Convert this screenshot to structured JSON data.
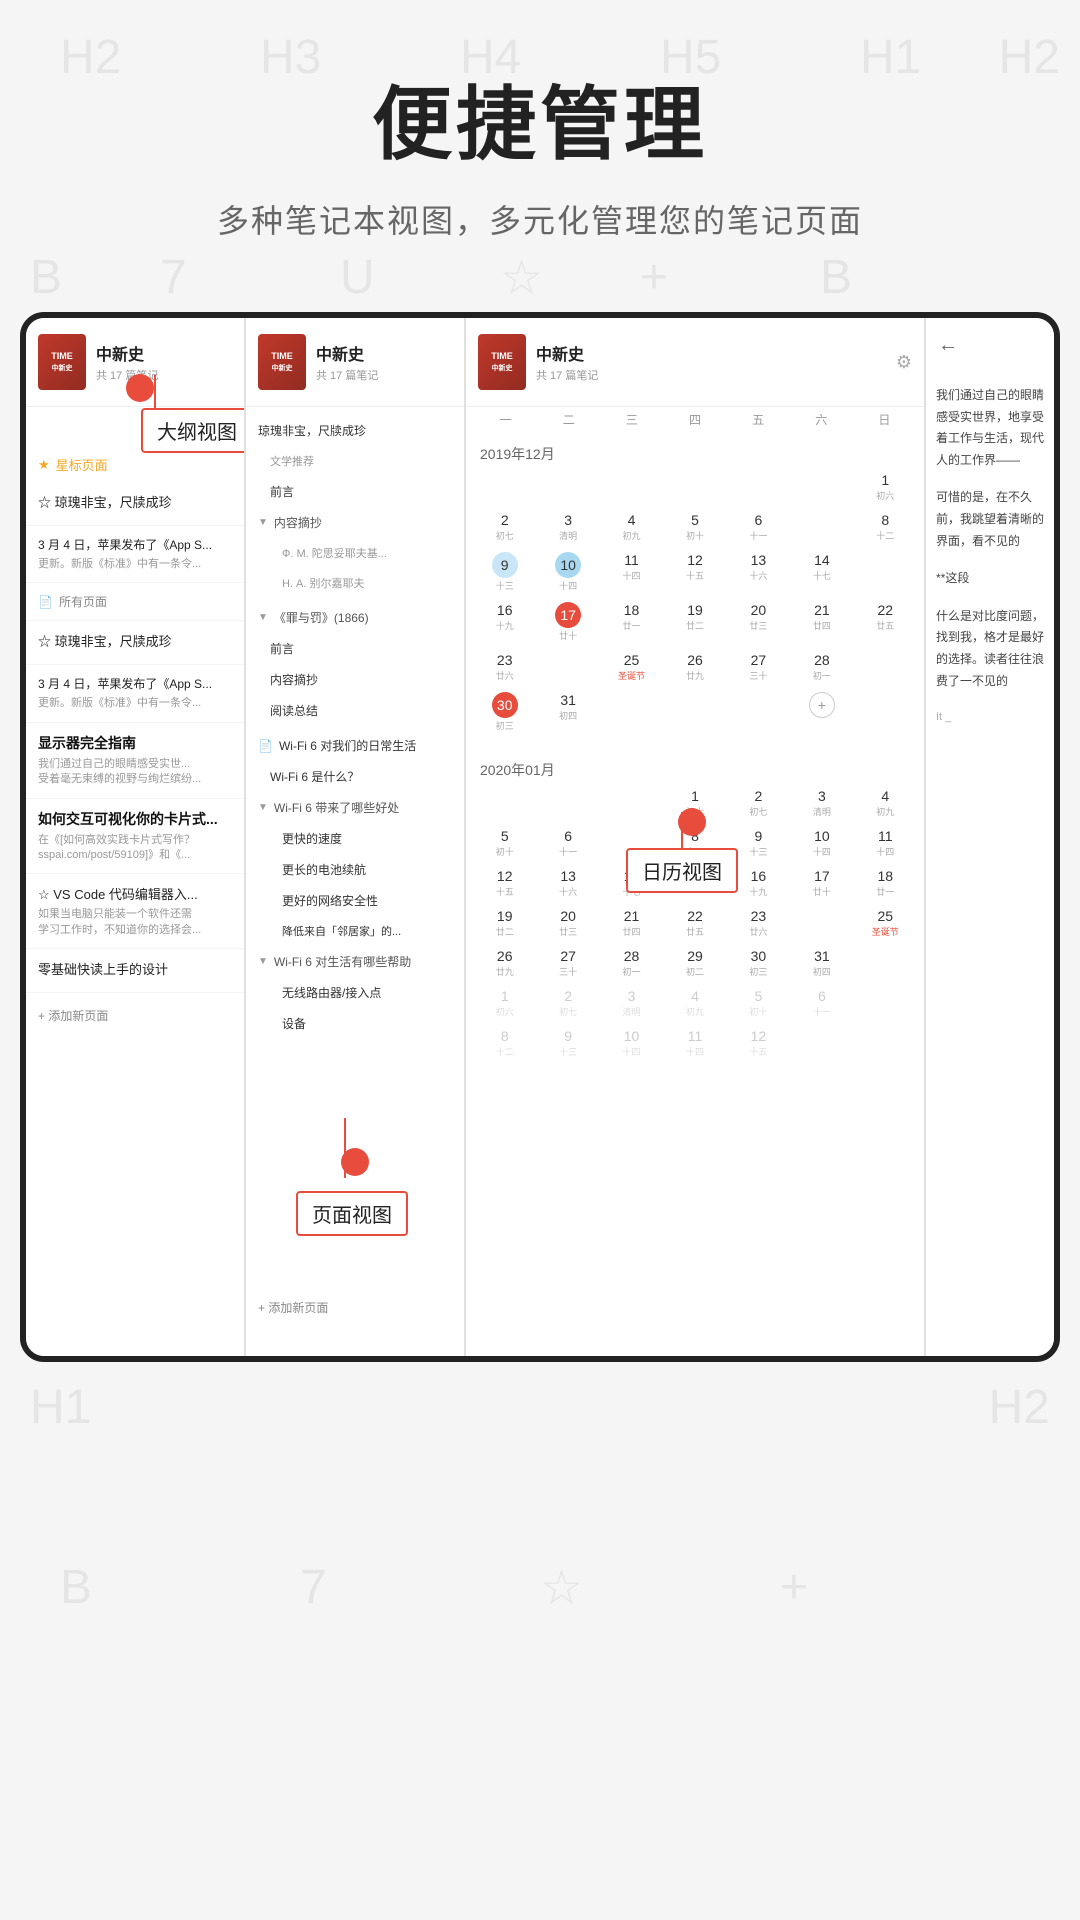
{
  "page": {
    "title": "便捷管理",
    "subtitle": "多种笔记本视图，多元化管理您的笔记页面"
  },
  "watermark_symbols": [
    "H2",
    "H3",
    "H4",
    "H5",
    "H2",
    "B",
    "7",
    "U",
    "☆",
    "+",
    "B",
    "H1",
    "H2"
  ],
  "notebook": {
    "name": "中新史",
    "count": "共 17 篇笔记",
    "count2": "共 17 篇笔记"
  },
  "panel1": {
    "label": "大纲视图",
    "starred_label": "星标页面",
    "items": [
      {
        "title": "☆ 琼瑰非宝，尺牍成珍",
        "desc": "",
        "type": "starred"
      },
      {
        "title": "3 月 4 日，苹果发布了《App S...",
        "desc": "更新。新版《标准》中有一条令...",
        "type": "desc"
      },
      {
        "title": "VS Code 代码编辑器入...",
        "desc": "如果当电脑只能装一个软件还需\n学习工作时，不知道你的选择会...",
        "type": "desc",
        "bold": true
      },
      {
        "title": "所有页面",
        "type": "section"
      },
      {
        "title": "☆ 琼瑰非宝，尺牍成珍",
        "type": "starred-plain"
      },
      {
        "title": "3 月 4 日，苹果发布了《App S...",
        "desc": "更新。新版《标准》中有一条令...",
        "type": "desc"
      },
      {
        "title": "显示器完全指南",
        "type": "bold-title"
      },
      {
        "title": "我们通过自己的眼睛感受实世...",
        "desc": "受着毫无束缚的视野与绚烂缤纷...",
        "type": "desc"
      },
      {
        "title": "如何交互可视化你的卡片式...",
        "type": "bold-title"
      },
      {
        "title": "在《[如何高效实践卡片式写作？sspai.com/post/59109]》和《...",
        "type": "desc-small"
      },
      {
        "title": "☆ VS Code 代码编辑器入...",
        "type": "starred-plain"
      },
      {
        "title": "如果当电脑只能装一个软件还需\n学习工作时，不知道你的选择会...",
        "type": "desc"
      },
      {
        "title": "零基础快读上手的设计",
        "type": "normal"
      }
    ],
    "add_page": "+ 添加新页面"
  },
  "panel2": {
    "label": "页面视图",
    "outline_items": [
      {
        "text": "琼瑰非宝，尺牍成珍",
        "type": "top",
        "indent": 0
      },
      {
        "text": "文学推荐",
        "type": "sub",
        "indent": 1
      },
      {
        "text": "前言",
        "type": "item",
        "indent": 1
      },
      {
        "text": "内容摘抄",
        "type": "expand",
        "indent": 1
      },
      {
        "text": "Ф. М. 陀思妥耶夫基...",
        "type": "item",
        "indent": 2
      },
      {
        "text": "Н. А. 别尔嘉耶夫",
        "type": "item",
        "indent": 2
      },
      {
        "text": "《罪与罚》(1866)",
        "type": "expand-item",
        "indent": 0
      },
      {
        "text": "前言",
        "type": "item",
        "indent": 1
      },
      {
        "text": "内容摘抄",
        "type": "item",
        "indent": 1
      },
      {
        "text": "阅读总结",
        "type": "item",
        "indent": 1
      },
      {
        "text": "Wi-Fi 6 对我们的日常生活",
        "type": "file",
        "indent": 0
      },
      {
        "text": "Wi-Fi 6 是什么？",
        "type": "item",
        "indent": 1
      },
      {
        "text": "Wi-Fi 6 带来了哪些好处",
        "type": "expand",
        "indent": 1
      },
      {
        "text": "更快的速度",
        "type": "item",
        "indent": 2
      },
      {
        "text": "更长的电池续航",
        "type": "item",
        "indent": 2
      },
      {
        "text": "更好的网络安全性",
        "type": "item",
        "indent": 2
      },
      {
        "text": "降低来自「邻居家」的...",
        "type": "item",
        "indent": 2
      },
      {
        "text": "Wi-Fi 6 对生活有哪些帮助",
        "type": "expand",
        "indent": 1
      },
      {
        "text": "无线路由器/接入点",
        "type": "item",
        "indent": 2
      },
      {
        "text": "设备",
        "type": "item",
        "indent": 2
      }
    ],
    "add_page": "+ 添加新页面"
  },
  "calendar": {
    "label": "日历视图",
    "month1": "2019年12月",
    "month2": "2020年01月",
    "month3": "2020年",
    "weekdays": [
      "一",
      "二",
      "三",
      "四",
      "五",
      "六",
      "日"
    ],
    "dec2019": [
      {
        "num": "",
        "lunar": ""
      },
      {
        "num": "",
        "lunar": ""
      },
      {
        "num": "",
        "lunar": ""
      },
      {
        "num": "",
        "lunar": ""
      },
      {
        "num": "",
        "lunar": ""
      },
      {
        "num": "",
        "lunar": ""
      },
      {
        "num": "1",
        "lunar": "初六"
      },
      {
        "num": "2",
        "lunar": "初七"
      },
      {
        "num": "3",
        "lunar": "清明"
      },
      {
        "num": "4",
        "lunar": "初九"
      },
      {
        "num": "5",
        "lunar": "初十"
      },
      {
        "num": "6",
        "lunar": "十一"
      },
      {
        "num": "8",
        "lunar": "十二"
      },
      {
        "num": "9",
        "lunar": "十三",
        "selected": true
      },
      {
        "num": "10",
        "lunar": "十四",
        "selected2": true
      },
      {
        "num": "11",
        "lunar": "十四"
      },
      {
        "num": "12",
        "lunar": "十五"
      },
      {
        "num": "13",
        "lunar": "十六"
      },
      {
        "num": "14",
        "lunar": "十七"
      },
      {
        "num": "16",
        "lunar": "十九"
      },
      {
        "num": "17",
        "lunar": "廿十",
        "today": true
      },
      {
        "num": "18",
        "lunar": "廿一"
      },
      {
        "num": "19",
        "lunar": "廿二"
      },
      {
        "num": "20",
        "lunar": "廿三"
      },
      {
        "num": "21",
        "lunar": "廿四"
      },
      {
        "num": "22",
        "lunar": "廿五"
      },
      {
        "num": "23",
        "lunar": "廿六"
      },
      {
        "num": "25",
        "lunar": "圣诞节",
        "special": true
      },
      {
        "num": "26",
        "lunar": "廿九"
      },
      {
        "num": "27",
        "lunar": "三十"
      },
      {
        "num": "28",
        "lunar": "初一"
      },
      {
        "num": "30",
        "lunar": "初三",
        "today2": true
      },
      {
        "num": "31",
        "lunar": "初四"
      },
      {
        "num": "",
        "lunar": ""
      },
      {
        "num": "+",
        "lunar": "",
        "add": true
      }
    ],
    "jan2020": [
      {
        "num": "",
        "lunar": ""
      },
      {
        "num": "",
        "lunar": ""
      },
      {
        "num": "",
        "lunar": ""
      },
      {
        "num": "1",
        "lunar": "初六"
      },
      {
        "num": "2",
        "lunar": "初七"
      },
      {
        "num": "3",
        "lunar": "清明"
      },
      {
        "num": "4",
        "lunar": "初九"
      },
      {
        "num": "5",
        "lunar": "初十"
      },
      {
        "num": "6",
        "lunar": "十一"
      },
      {
        "num": "8",
        "lunar": "十二"
      },
      {
        "num": "9",
        "lunar": "十三"
      },
      {
        "num": "10",
        "lunar": "十四"
      },
      {
        "num": "11",
        "lunar": "十四"
      },
      {
        "num": "12",
        "lunar": "十五"
      },
      {
        "num": "13",
        "lunar": "十六"
      },
      {
        "num": "14",
        "lunar": "十七"
      },
      {
        "num": "16",
        "lunar": "十九"
      },
      {
        "num": "17",
        "lunar": "廿十"
      },
      {
        "num": "18",
        "lunar": "廿一"
      },
      {
        "num": "19",
        "lunar": "廿二"
      },
      {
        "num": "20",
        "lunar": "廿三"
      },
      {
        "num": "21",
        "lunar": "廿四"
      },
      {
        "num": "22",
        "lunar": "廿五"
      },
      {
        "num": "23",
        "lunar": "廿六"
      },
      {
        "num": "25",
        "lunar": "圣诞节",
        "special": true
      },
      {
        "num": "26",
        "lunar": "廿九"
      },
      {
        "num": "27",
        "lunar": "三十"
      },
      {
        "num": "28",
        "lunar": "初一"
      },
      {
        "num": "29",
        "lunar": "初二"
      },
      {
        "num": "30",
        "lunar": "初三"
      },
      {
        "num": "31",
        "lunar": "初四"
      }
    ]
  },
  "reading": {
    "text1": "我们通过自己的眼睛感受实世界，地享受着工作与生活，现代人的工作界——",
    "text2": "可惜的是，在不久前，我跳望着清晰的界面，看不见的",
    "text3": "**这段",
    "text4": "什么是对比度问题，找到我，格才是最好的选择。读者往往浪费了一不见的"
  },
  "colors": {
    "red": "#e74c3c",
    "light_blue": "#c8e6f5",
    "border": "#e0e0e0",
    "text_primary": "#222",
    "text_secondary": "#666",
    "text_light": "#aaa"
  }
}
